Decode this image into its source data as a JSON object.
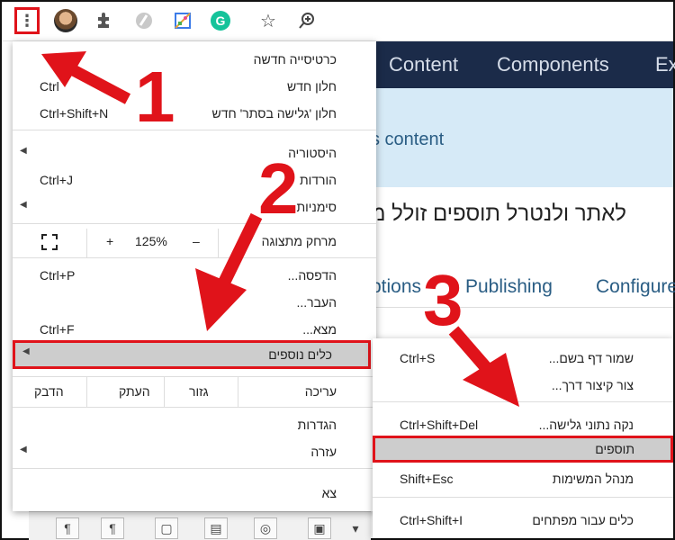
{
  "toolbar": {
    "icons": [
      "kebab-menu-icon",
      "avatar",
      "puzzle-icon",
      "gray-extension-icon",
      "colorful-extension-icon",
      "grammarly-icon",
      "star-icon",
      "zoom-icon"
    ],
    "kebab_glyph": "⋮",
    "star_glyph": "☆",
    "grammarly_glyph": "G"
  },
  "site": {
    "nav": [
      "Content",
      "Components",
      "Ex"
    ],
    "alert": "s content",
    "heading": "לאתר ולנטרל תוספים זולל מ",
    "tabs": [
      "ptions",
      "Publishing",
      "Configure"
    ]
  },
  "menu": {
    "new_tab": "כרטיסייה חדשה",
    "new_window": "חלון חדש",
    "new_window_shortcut": "Ctrl",
    "incognito": "חלון 'גלישה בסתר' חדש",
    "incognito_shortcut": "Ctrl+Shift+N",
    "history": "היסטוריה",
    "downloads": "הורדות",
    "downloads_shortcut": "Ctrl+J",
    "bookmarks": "סימניות",
    "zoom_label": "מרחק מתצוגה",
    "zoom_minus": "–",
    "zoom_value": "125%",
    "zoom_plus": "+",
    "print": "הדפסה...",
    "print_shortcut": "Ctrl+P",
    "cast": "העבר...",
    "find": "מצא...",
    "find_shortcut": "Ctrl+F",
    "more_tools": "כלים נוספים",
    "edit": "עריכה",
    "cut": "גזור",
    "copy": "העתק",
    "paste": "הדבק",
    "settings": "הגדרות",
    "help": "עזרה",
    "exit": "צא"
  },
  "submenu": {
    "save_page": "שמור דף בשם...",
    "save_page_shortcut": "Ctrl+S",
    "create_shortcut": "צור קיצור דרך...",
    "clear_data": "נקה נתוני גלישה...",
    "clear_data_shortcut": "Ctrl+Shift+Del",
    "extensions": "תוספים",
    "task_manager": "מנהל המשימות",
    "task_manager_shortcut": "Shift+Esc",
    "dev_tools": "כלים עבור מפתחים",
    "dev_tools_shortcut": "Ctrl+Shift+I"
  },
  "annotations": {
    "step1": "1",
    "step2": "2",
    "step3": "3",
    "color": "#e0131a"
  }
}
